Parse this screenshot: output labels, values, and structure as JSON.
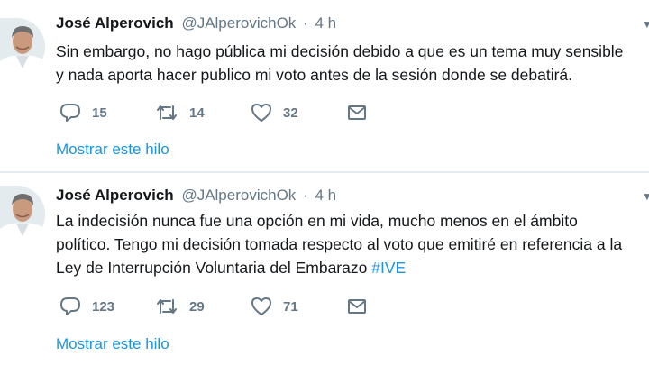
{
  "tweets": [
    {
      "author_name": "José Alperovich",
      "handle": "@JAlperovichOk",
      "separator": "·",
      "time": "4 h",
      "text_lines": [
        "Sin embargo, no hago pública mi decisión debido a que es un tema muy sensible",
        "y nada aporta hacer publico mi voto antes de la sesión donde se debatirá."
      ],
      "replies": "15",
      "retweets": "14",
      "likes": "32",
      "show_thread": "Mostrar este hilo"
    },
    {
      "author_name": "José Alperovich",
      "handle": "@JAlperovichOk",
      "separator": "·",
      "time": "4 h",
      "text_lines": [
        "La indecisión nunca fue una opción en mi vida, mucho menos en el ámbito",
        "político. Tengo mi decisión tomada respecto al voto que emitiré en referencia a la",
        "Ley de Interrupción Voluntaria del Embarazo "
      ],
      "hashtag": "#IVE",
      "replies": "123",
      "retweets": "29",
      "likes": "71",
      "show_thread": "Mostrar este hilo"
    }
  ],
  "icons": {
    "reply": "reply-icon",
    "retweet": "retweet-icon",
    "like": "heart-icon",
    "message": "direct-message-icon",
    "caret": "chevron-down-icon"
  },
  "colors": {
    "link": "#1b95e0",
    "secondary_text": "#657786",
    "primary_text": "#14171a",
    "divider": "#e6ecf0"
  }
}
